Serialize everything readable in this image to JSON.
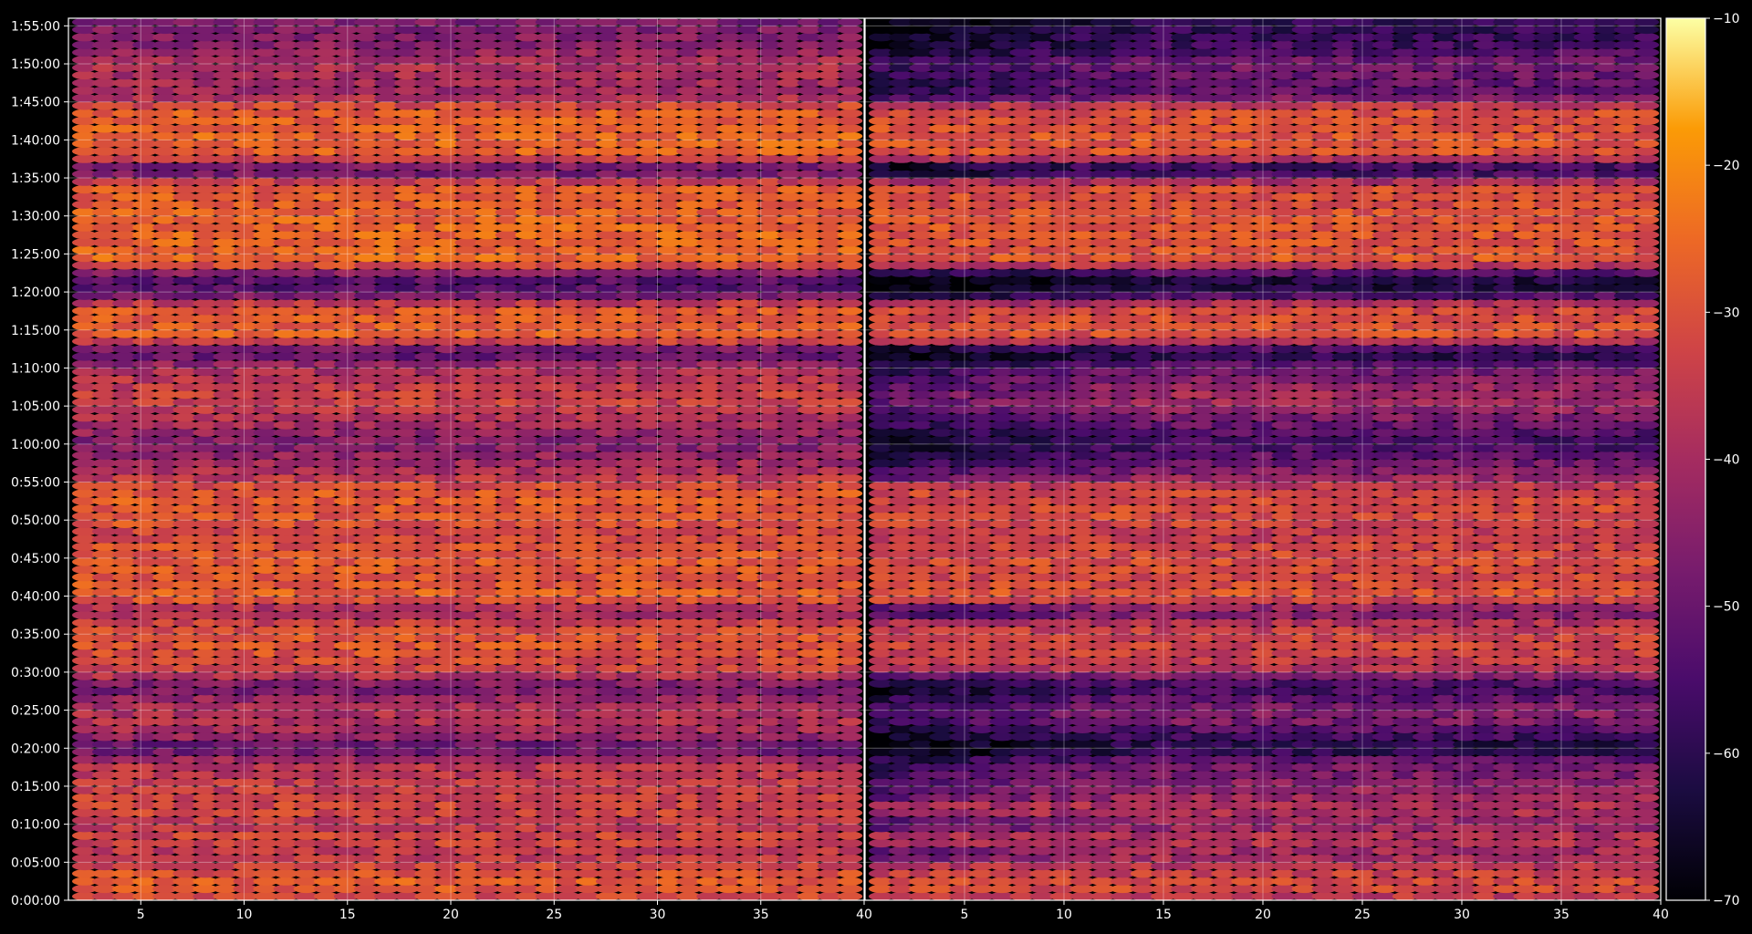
{
  "chart_data": {
    "type": "heatmap",
    "title": "",
    "xlabel": "",
    "ylabel": "",
    "colormap": "inferno",
    "grid": true,
    "panels": [
      {
        "name": "",
        "xlim": [
          1.5,
          40
        ],
        "x_ticks": [
          5,
          10,
          15,
          20,
          25,
          30,
          35,
          40
        ]
      },
      {
        "name": "",
        "xlim": [
          0,
          40
        ],
        "x_ticks": [
          5,
          10,
          15,
          20,
          25,
          30,
          35,
          40
        ]
      }
    ],
    "x_tick_labels": [
      "5",
      "10",
      "15",
      "20",
      "25",
      "30",
      "35",
      "40"
    ],
    "ylim_seconds": [
      0,
      6960
    ],
    "y_tick_labels": [
      "0:00:00",
      "0:05:00",
      "0:10:00",
      "0:15:00",
      "0:20:00",
      "0:25:00",
      "0:30:00",
      "0:35:00",
      "0:40:00",
      "0:45:00",
      "0:50:00",
      "0:55:00",
      "1:00:00",
      "1:05:00",
      "1:10:00",
      "1:15:00",
      "1:20:00",
      "1:25:00",
      "1:30:00",
      "1:35:00",
      "1:40:00",
      "1:45:00",
      "1:50:00",
      "1:55:00"
    ],
    "colorbar": {
      "range": [
        -70,
        -10
      ],
      "ticks": [
        -70,
        -60,
        -50,
        -40,
        -30,
        -20,
        -10
      ],
      "tick_labels": [
        "−70",
        "−60",
        "−50",
        "−40",
        "−30",
        "−20",
        "−10"
      ]
    },
    "channels": 39,
    "row_interval_seconds": 60,
    "band_profile": {
      "minutes": [
        0,
        2,
        4,
        6,
        8,
        10,
        12,
        14,
        16,
        18,
        20,
        22,
        24,
        26,
        28,
        30,
        32,
        34,
        36,
        38,
        40,
        42,
        44,
        46,
        48,
        50,
        52,
        54,
        56,
        58,
        60,
        62,
        64,
        66,
        68,
        70,
        72,
        74,
        76,
        78,
        80,
        82,
        84,
        86,
        88,
        90,
        92,
        94,
        96,
        98,
        100,
        102,
        104,
        106,
        108,
        110,
        112,
        114,
        116
      ],
      "left_db": [
        -34,
        -27,
        -31,
        -37,
        -32,
        -36,
        -32,
        -34,
        -36,
        -37,
        -52,
        -40,
        -38,
        -40,
        -50,
        -34,
        -30,
        -29,
        -31,
        -42,
        -26,
        -30,
        -28,
        -29,
        -33,
        -29,
        -28,
        -29,
        -38,
        -42,
        -47,
        -42,
        -37,
        -33,
        -36,
        -40,
        -54,
        -27,
        -28,
        -29,
        -54,
        -52,
        -25,
        -27,
        -26,
        -27,
        -28,
        -28,
        -54,
        -27,
        -26,
        -27,
        -28,
        -42,
        -40,
        -38,
        -44,
        -46,
        -48
      ],
      "right_db": [
        -38,
        -30,
        -35,
        -42,
        -37,
        -44,
        -38,
        -42,
        -46,
        -48,
        -62,
        -55,
        -45,
        -48,
        -58,
        -40,
        -34,
        -33,
        -35,
        -48,
        -28,
        -33,
        -31,
        -32,
        -36,
        -32,
        -31,
        -33,
        -45,
        -50,
        -56,
        -52,
        -45,
        -40,
        -44,
        -50,
        -63,
        -30,
        -31,
        -32,
        -62,
        -62,
        -28,
        -30,
        -29,
        -30,
        -31,
        -31,
        -64,
        -30,
        -29,
        -30,
        -31,
        -52,
        -50,
        -48,
        -56,
        -58,
        -60
      ]
    }
  }
}
